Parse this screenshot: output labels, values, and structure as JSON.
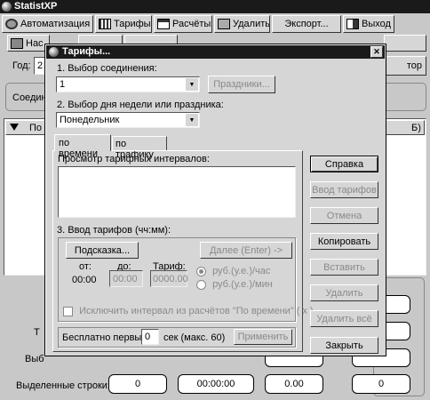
{
  "app": {
    "title": "StatistXP",
    "toolbar": [
      {
        "label": "Автоматизация",
        "icon": "automation-icon"
      },
      {
        "label": "Тарифы",
        "icon": "tariffs-icon"
      },
      {
        "label": "Расчёты",
        "icon": "calculations-icon"
      },
      {
        "label": "Удалить",
        "icon": "delete-icon"
      },
      {
        "label": "Экспорт...",
        "icon": ""
      },
      {
        "label": "Выход",
        "icon": "exit-icon"
      }
    ],
    "toolbar2_first": "Нас",
    "year_label": "Год:",
    "year_value": "2",
    "right_btn": "тор",
    "conn_label": "Соедин",
    "grid_header_left": "По",
    "grid_header_right": "Б)",
    "row_t": "Т",
    "row_vyb": "Выб",
    "selected_rows_label": "Выделенные строки:",
    "selected_values": [
      "0",
      "00:00:00",
      "0.00",
      "0"
    ]
  },
  "dialog": {
    "title": "Тарифы...",
    "close_label": "✕",
    "section1": "1. Выбор соединения:",
    "connection_value": "1",
    "holidays_btn": "Праздники...",
    "section2": "2. Выбор дня недели или праздника:",
    "day_value": "Понедельник",
    "tabs": [
      "по времени",
      "по трафику"
    ],
    "view_label": "Просмотр тарифных интервалов:",
    "section3": "3. Ввод тарифов (чч:мм):",
    "hint_btn": "Подсказка...",
    "next_btn": "Далее (Enter) ->",
    "from_label": "от:",
    "to_label": "до:",
    "tariff_label": "Тариф:",
    "from_value": "00:00",
    "to_value": "00:00",
    "tariff_value": "0000.00",
    "radio1": "руб.(у.е.)/час",
    "radio2": "руб.(у.е.)/мин",
    "exclude_label": "Исключить интервал из расчётов \"По времени\" ( х )",
    "free_label": "Бесплатно первые",
    "free_value": "0",
    "free_unit": "сек (макс. 60)",
    "apply_btn": "Применить",
    "side_buttons": [
      "Справка",
      "Ввод тарифов",
      "Отмена",
      "Копировать",
      "Вставить",
      "Удалить",
      "Удалить всё",
      "Закрыть"
    ]
  }
}
